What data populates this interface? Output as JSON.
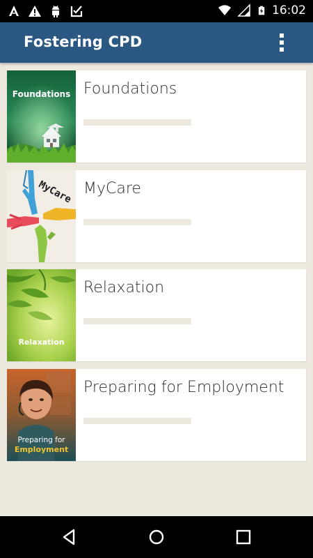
{
  "status_bar": {
    "time": "16:02",
    "icons": [
      "notification-a-icon",
      "warning-icon",
      "android-icon",
      "download-done-icon",
      "wifi-icon",
      "signal-icon",
      "battery-charging-icon"
    ]
  },
  "app_bar": {
    "title": "Fostering CPD",
    "menu_icon": "overflow-menu-icon"
  },
  "courses": [
    {
      "title": "Foundations",
      "thumb_label": "Foundations",
      "progress": 0
    },
    {
      "title": "MyCare",
      "thumb_label": "MyCare",
      "progress": 0
    },
    {
      "title": "Relaxation",
      "thumb_label": "Relaxation",
      "progress": 0
    },
    {
      "title": "Preparing for Employment",
      "thumb_label_line1": "Preparing for",
      "thumb_label_line2": "Employment",
      "progress": 0
    }
  ],
  "nav_bar": {
    "icons": [
      "back-icon",
      "home-icon",
      "recents-icon"
    ]
  },
  "colors": {
    "app_bar": "#2b5783",
    "background": "#ede9df",
    "card": "#ffffff"
  }
}
